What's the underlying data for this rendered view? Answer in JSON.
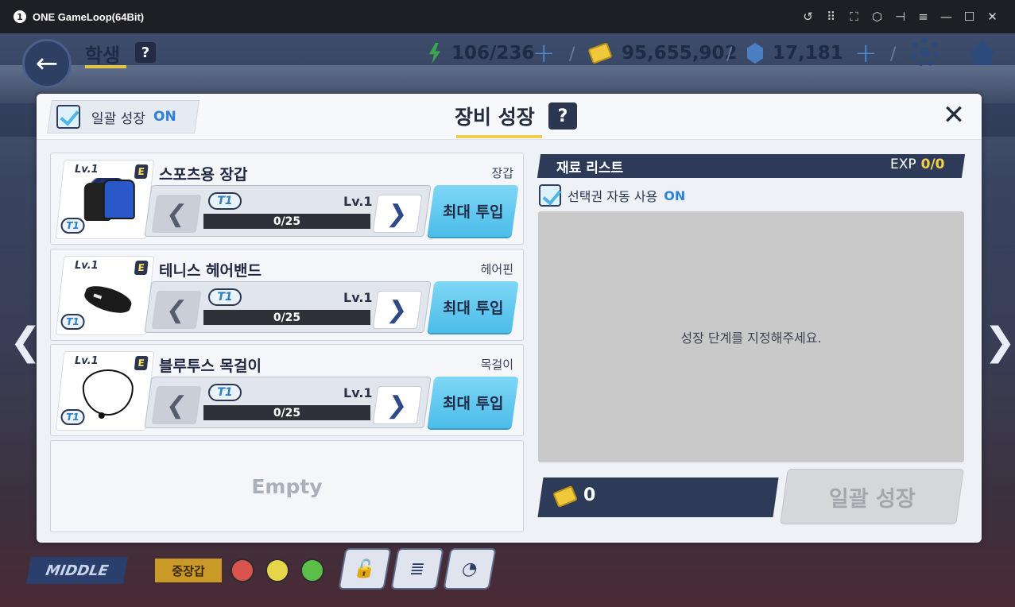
{
  "window": {
    "badge": "1",
    "title": "ONE GameLoop(64Bit)",
    "controls": [
      "undo-icon",
      "keyboard-icon",
      "fullscreen-icon",
      "cube-icon",
      "pin-icon",
      "menu-icon",
      "minimize-icon",
      "maximize-icon",
      "close-icon"
    ]
  },
  "hud": {
    "back_glyph": "←",
    "title": "학생",
    "help": "?",
    "stamina": "106/236",
    "gold": "95,655,902",
    "gems": "17,181",
    "plus": "+",
    "sep": "/"
  },
  "nav": {
    "left": "❮",
    "right": "❯"
  },
  "bottom": {
    "position_label": "MIDDLE",
    "tag_label": "중장갑"
  },
  "modal": {
    "bulk_growth_label": "일괄 성장",
    "bulk_growth_state": "ON",
    "title": "장비 성장",
    "help": "?",
    "close": "✕"
  },
  "equipment": [
    {
      "name": "스포츠용 장갑",
      "type": "장갑",
      "lv_badge": "Lv.1",
      "grade": "E",
      "tier": "T1",
      "level": "Lv.1",
      "exp": "0/25",
      "max_label": "최대 투입",
      "prev": "❮",
      "next": "❯"
    },
    {
      "name": "테니스 헤어밴드",
      "type": "헤어핀",
      "lv_badge": "Lv.1",
      "grade": "E",
      "tier": "T1",
      "level": "Lv.1",
      "exp": "0/25",
      "max_label": "최대 투입",
      "prev": "❮",
      "next": "❯"
    },
    {
      "name": "블루투스 목걸이",
      "type": "목걸이",
      "lv_badge": "Lv.1",
      "grade": "E",
      "tier": "T1",
      "level": "Lv.1",
      "exp": "0/25",
      "max_label": "최대 투입",
      "prev": "❮",
      "next": "❯"
    }
  ],
  "empty_slot": "Empty",
  "materials": {
    "title": "재료 리스트",
    "exp_label": "EXP",
    "exp_value": "0/0",
    "auto_label": "선택권 자동 사용",
    "auto_state": "ON",
    "placeholder": "성장 단계를 지정해주세요.",
    "cost": "0",
    "bulk_button": "일괄 성장"
  }
}
